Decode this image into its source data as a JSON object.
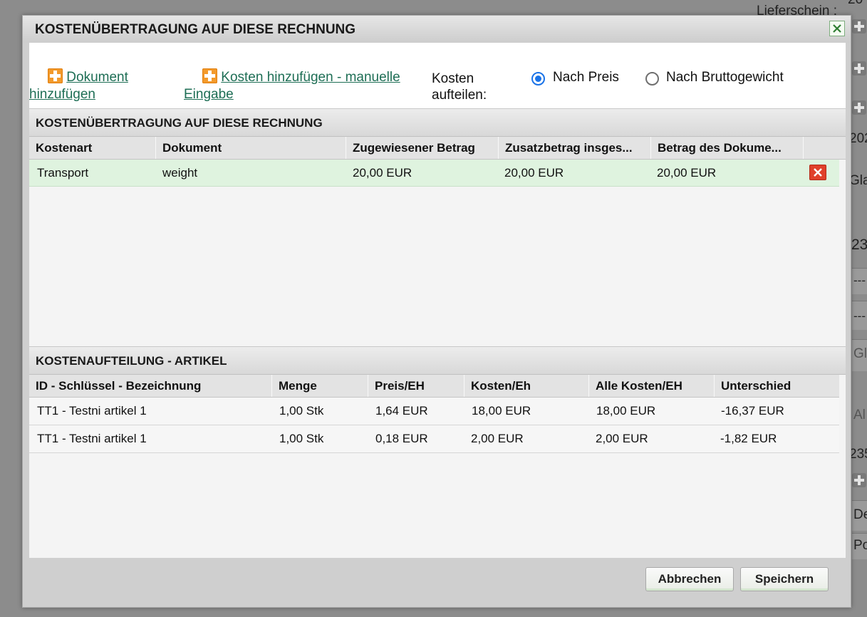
{
  "background": {
    "lieferschein_label": "Lieferschein :",
    "frag_20_top": "20",
    "frag_202": "202",
    "frag_gla": "Gla",
    "frag_23": "23",
    "frag_dash1": "---",
    "frag_dash2": "---",
    "frag_gl": "Gl",
    "frag_al": "Al",
    "frag_235": "235",
    "frag_de": "De",
    "frag_po": "Po"
  },
  "dialog": {
    "title": "KOSTENÜBERTRAGUNG AUF DIESE RECHNUNG",
    "close_icon": "close-icon"
  },
  "toolbar": {
    "add_document_line1": "Dokument",
    "add_document_line2": "hinzufügen",
    "add_costs_line1": "Kosten hinzufügen - manuelle",
    "add_costs_line2": "Eingabe",
    "split_label_line1": "Kosten",
    "split_label_line2": "aufteilen:",
    "radio_price": "Nach Preis",
    "radio_weight": "Nach Bruttogewicht",
    "selected": "Nach Preis"
  },
  "transfer_section": {
    "title": "KOSTENÜBERTRAGUNG AUF DIESE RECHNUNG",
    "columns": [
      "Kostenart",
      "Dokument",
      "Zugewiesener Betrag",
      "Zusatzbetrag insges...",
      "Betrag des Dokume..."
    ],
    "rows": [
      {
        "kostenart": "Transport",
        "dokument": "weight",
        "zugewiesen": "20,00 EUR",
        "zusatz": "20,00 EUR",
        "betrag": "20,00 EUR"
      }
    ]
  },
  "allocation_section": {
    "title": "KOSTENAUFTEILUNG - ARTIKEL",
    "columns": [
      "ID - Schlüssel - Bezeichnung",
      "Menge",
      "Preis/EH",
      "Kosten/Eh",
      "Alle Kosten/EH",
      "Unterschied"
    ],
    "rows": [
      {
        "id": "TT1 - Testni artikel 1",
        "menge": "1,00 Stk",
        "preis": "1,64 EUR",
        "kosten": "18,00 EUR",
        "alle": "18,00 EUR",
        "diff": "-16,37 EUR"
      },
      {
        "id": "TT1 - Testni artikel 1",
        "menge": "1,00 Stk",
        "preis": "0,18 EUR",
        "kosten": "2,00 EUR",
        "alle": "2,00 EUR",
        "diff": "-1,82 EUR"
      }
    ]
  },
  "footer": {
    "cancel": "Abbrechen",
    "save": "Speichern"
  }
}
